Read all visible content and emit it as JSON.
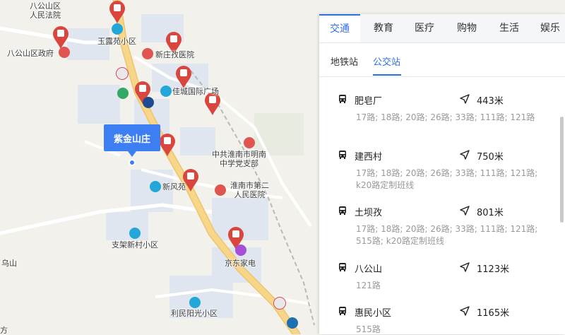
{
  "map": {
    "labels": {
      "bagongshan_court": "八公山区\n人民法院",
      "yuluyuan": "玉露苑小区",
      "bagongshan_gov": "八公山区政府",
      "xinzhuangzi_hospital": "新庄孜医院",
      "jiacheng_plaza": "佳城国际广场",
      "party_branch": "中共淮南市明南\n中学党支部",
      "xinfengyuan": "新风苑",
      "hospital2": "淮南市第二\n人民医院",
      "zhijia_xincun": "支架新村小区",
      "jd_appliance": "京东家电",
      "wushan": "乌山",
      "limin_yangguang": "利民阳光小区",
      "edge_fang": "方"
    },
    "selected_marker": "紫金山庄"
  },
  "panel": {
    "categories": [
      "交通",
      "教育",
      "医疗",
      "购物",
      "生活",
      "娱乐"
    ],
    "active_category": "交通",
    "sub_tabs": [
      "地铁站",
      "公交站"
    ],
    "active_sub_tab": "公交站",
    "stops": [
      {
        "name": "肥皂厂",
        "distance": "443米",
        "routes": "17路; 18路; 20路; 26路; 33路; 111路; 121路"
      },
      {
        "name": "建西村",
        "distance": "750米",
        "routes": "17路; 18路; 20路; 26路; 33路; 111路; 121路; k20路定制班线"
      },
      {
        "name": "土坝孜",
        "distance": "801米",
        "routes": "17路; 18路; 20路; 26路; 33路; 111路; 121路; 515路; k20路定制班线"
      },
      {
        "name": "八公山",
        "distance": "1123米",
        "routes": "121路"
      },
      {
        "name": "惠民小区",
        "distance": "1165米",
        "routes": "515路"
      }
    ]
  },
  "colors": {
    "accent": "#2f6fe4",
    "pin_red": "#d9463e",
    "poi_blue": "#22a7d8",
    "road": "#f7d589"
  },
  "icons": [
    "bus-icon",
    "navigate-arrow-icon",
    "bus-stop-pin-icon",
    "hospital-icon",
    "residential-icon",
    "government-icon"
  ]
}
